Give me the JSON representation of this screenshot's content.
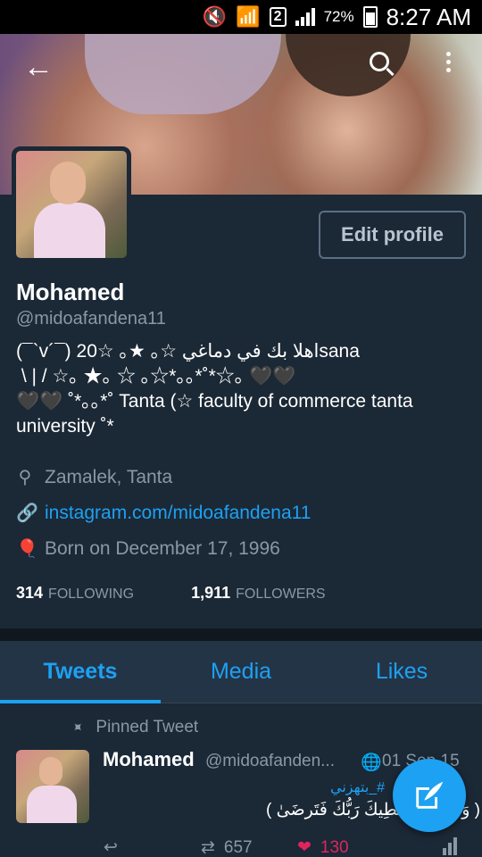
{
  "status_bar": {
    "battery": "72%",
    "time": "8:27 AM",
    "sim": "2"
  },
  "profile": {
    "name": "Mohamed",
    "handle": "@midoafandena11",
    "bio": "(¯`v´¯) اهلا بك في دماغي ☆｡ ★｡ ☆20sana\n \\ | / ☆｡ ★｡ ☆ ｡☆*｡｡*˚*☆｡ 🖤🖤\n🖤🖤 ˚*｡｡*˚ Tanta (☆ faculty of commerce tanta university ˚*",
    "location": "Zamalek, Tanta",
    "website": "instagram.com/midoafandena11",
    "birthday": "Born on December 17, 1996",
    "edit_label": "Edit profile"
  },
  "counts": {
    "following_value": "314",
    "following_label": "FOLLOWING",
    "followers_value": "1,911",
    "followers_label": "FOLLOWERS"
  },
  "tabs": [
    {
      "label": "Tweets",
      "active": true
    },
    {
      "label": "Media",
      "active": false
    },
    {
      "label": "Likes",
      "active": false
    }
  ],
  "tweet": {
    "pinned_label": "Pinned Tweet",
    "author": "Mohamed",
    "handle": "@midoafanden...",
    "date": "01 Sep 15",
    "hashtag": "#_بتهزني",
    "text": "( وَلَسَوفَ يُعطِيكَ رَبُّكَ فَتَرضَىٰ )",
    "retweets": "657",
    "likes": "130"
  },
  "icons": {
    "back": "arrow-left-icon",
    "search": "search-icon",
    "more": "more-vertical-icon",
    "location": "location-pin-icon",
    "link": "link-icon",
    "birthday": "balloon-icon",
    "pin": "pin-icon",
    "globe": "globe-icon",
    "reply": "reply-icon",
    "retweet": "retweet-icon",
    "like": "heart-icon",
    "stats": "stats-icon",
    "compose": "compose-icon"
  },
  "colors": {
    "accent": "#1da1f2",
    "like": "#e0245e",
    "background": "#1b2836"
  }
}
